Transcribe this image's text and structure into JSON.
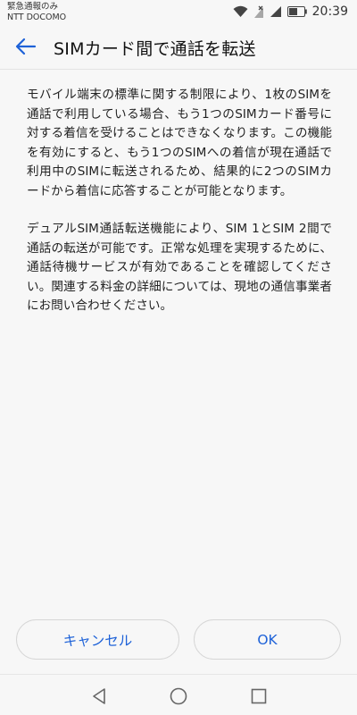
{
  "status_bar": {
    "carrier_line1": "緊急通報のみ",
    "carrier_line2": "NTT DOCOMO",
    "time": "20:39",
    "icons": [
      "wifi-icon",
      "no-sim-icon",
      "signal-icon",
      "battery-icon"
    ]
  },
  "header": {
    "back_icon": "arrow-left-icon",
    "title": "SIMカード間で通話を転送"
  },
  "content": {
    "paragraph1": "モバイル端末の標準に関する制限により、1枚のSIMを通話で利用している場合、もう1つのSIMカード番号に対する着信を受けることはできなくなります。この機能を有効にすると、もう1つのSIMへの着信が現在通話で利用中のSIMに転送されるため、結果的に2つのSIMカードから着信に応答することが可能となります。",
    "paragraph2": "デュアルSIM通話転送機能により、SIM 1とSIM 2間で通話の転送が可能です。正常な処理を実現するために、通話待機サービスが有効であることを確認してください。関連する料金の詳細については、現地の通信事業者にお問い合わせください。"
  },
  "buttons": {
    "cancel_label": "キャンセル",
    "ok_label": "OK"
  },
  "navigation": {
    "icons": [
      "back-triangle-icon",
      "home-circle-icon",
      "recents-square-icon"
    ]
  },
  "colors": {
    "accent": "#1e62d8",
    "background": "#f7f7f7"
  }
}
